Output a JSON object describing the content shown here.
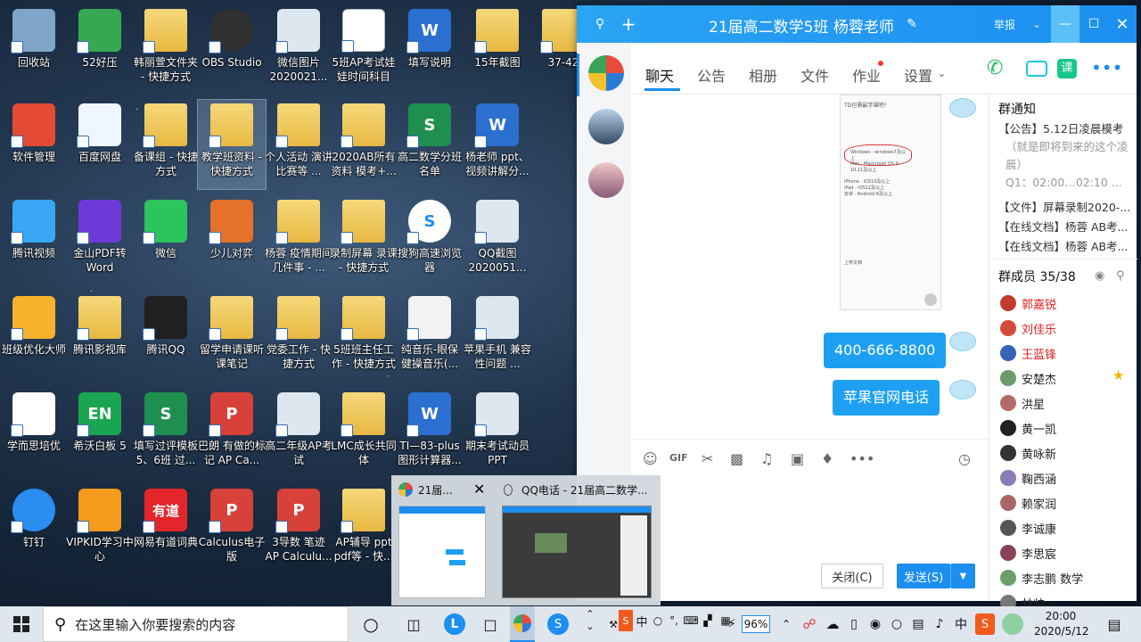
{
  "desktop_icons": [
    {
      "label": "回收站",
      "kind": "recycle"
    },
    {
      "label": "52好压",
      "kind": "zip"
    },
    {
      "label": "韩丽萱文件夹 - 快捷方式",
      "kind": "folder"
    },
    {
      "label": "OBS Studio",
      "kind": "obs"
    },
    {
      "label": "微信图片 2020021...",
      "kind": "image"
    },
    {
      "label": "5班AP考试娃娃时间科目",
      "kind": "doc"
    },
    {
      "label": "填写说明",
      "kind": "word"
    },
    {
      "label": "15年截图",
      "kind": "folder"
    },
    {
      "label": "37-42",
      "kind": "folder"
    },
    {
      "label": "软件管理",
      "kind": "softmgr"
    },
    {
      "label": "百度网盘",
      "kind": "baidu"
    },
    {
      "label": "备课组 - 快捷方式",
      "kind": "folder"
    },
    {
      "label": "教学班资料 - 快捷方式",
      "kind": "folder"
    },
    {
      "label": "个人活动 演讲 比赛等 ...",
      "kind": "folder"
    },
    {
      "label": "2020AB所有资料 模考+...",
      "kind": "folder"
    },
    {
      "label": "高二数学分班名单",
      "kind": "excel"
    },
    {
      "label": "杨老师 ppt、视频讲解分...",
      "kind": "word"
    },
    {
      "label": "腾讯视频",
      "kind": "tvideo"
    },
    {
      "label": "金山PDF转Word",
      "kind": "jspdf"
    },
    {
      "label": "微信",
      "kind": "wechat"
    },
    {
      "label": "少儿对弈",
      "kind": "chess"
    },
    {
      "label": "杨蓉 疫情期间几件事 - ...",
      "kind": "folder"
    },
    {
      "label": "录制屏幕 录课 - 快捷方式",
      "kind": "folder"
    },
    {
      "label": "搜狗高速浏览器",
      "kind": "sogou"
    },
    {
      "label": "QQ截图 2020051...",
      "kind": "image"
    },
    {
      "label": "班级优化大师",
      "kind": "banji"
    },
    {
      "label": "腾讯影视库",
      "kind": "folder"
    },
    {
      "label": "腾讯QQ",
      "kind": "qq"
    },
    {
      "label": "留学申请课听课笔记",
      "kind": "folder"
    },
    {
      "label": "党委工作 - 快捷方式",
      "kind": "folder"
    },
    {
      "label": "5班班主任工作 - 快捷方式",
      "kind": "folder"
    },
    {
      "label": "纯音乐-眼保健操音乐(...",
      "kind": "music"
    },
    {
      "label": "苹果手机 兼容性问题 ...",
      "kind": "image"
    },
    {
      "label": "学而思培优",
      "kind": "xes"
    },
    {
      "label": "希沃白板 5",
      "kind": "en"
    },
    {
      "label": "填写过评模板5、6班 过...",
      "kind": "excel"
    },
    {
      "label": "巴朗 有做的标记 AP Ca...",
      "kind": "pdf"
    },
    {
      "label": "高二年级AP考试",
      "kind": "image"
    },
    {
      "label": "LMC成长共同体",
      "kind": "folder"
    },
    {
      "label": "TI—83-plus图形计算器...",
      "kind": "word"
    },
    {
      "label": "期末考试动员PPT",
      "kind": "image"
    },
    {
      "label": "钉钉",
      "kind": "dingtalk"
    },
    {
      "label": "VIPKID学习中心",
      "kind": "vipkid"
    },
    {
      "label": "网易有道词典",
      "kind": "youdao"
    },
    {
      "label": "Calculus电子版",
      "kind": "pdf"
    },
    {
      "label": "3导数 笔迹 AP Calculu...",
      "kind": "pdf"
    },
    {
      "label": "AP辅导 ppt pdf等 - 快...",
      "kind": "folder"
    }
  ],
  "qq_window": {
    "title": "21届高二数学5班 杨蓉老师",
    "report": "举报",
    "tabs": [
      "聊天",
      "公告",
      "相册",
      "文件",
      "作业",
      "设置"
    ],
    "messages": [
      "400-666-8800",
      "苹果官网电话"
    ],
    "screenshot_text": {
      "head": "TD也需最学课吧?",
      "lines": [
        "Windows · windows7及以上",
        "Mac · Macintosh OS X 10.11及以上",
        "iPhone · iOS10及以上",
        "iPad · iOS12及以上",
        "安卓 · Android 8及以上"
      ],
      "foot": "上传文档"
    },
    "close_label": "关闭(C)",
    "send_label": "发送(S)",
    "notice_title": "群通知",
    "notices": [
      "【公告】5.12日凌晨模考",
      "（就是即将到来的这个凌",
      "晨）",
      "Q1：02:00…02:10 ...",
      "【文件】屏幕录制2020-...",
      "【在线文档】杨蓉 AB考...",
      "【在线文档】杨蓉 AB考..."
    ],
    "members_title": "群成员 35/38",
    "members": [
      {
        "name": "郭嘉锐",
        "color": "#e02020"
      },
      {
        "name": "刘佳乐",
        "color": "#e02020"
      },
      {
        "name": "王蓝锋",
        "color": "#e02020"
      },
      {
        "name": "安楚杰",
        "color": "#222222"
      },
      {
        "name": "洪星",
        "color": "#222222"
      },
      {
        "name": "黄一凯",
        "color": "#222222"
      },
      {
        "name": "黄咏新",
        "color": "#222222"
      },
      {
        "name": "鞠西涵",
        "color": "#222222"
      },
      {
        "name": "赖家润",
        "color": "#222222"
      },
      {
        "name": "李诚康",
        "color": "#222222"
      },
      {
        "name": "李思宸",
        "color": "#222222"
      },
      {
        "name": "李志鹏 数学",
        "color": "#222222"
      },
      {
        "name": "林帅",
        "color": "#222222"
      }
    ]
  },
  "thumbnails": [
    {
      "title": "21届..."
    },
    {
      "title": "QQ电话 - 21届高二数学..."
    }
  ],
  "taskbar": {
    "search_placeholder": "在这里输入你要搜索的内容",
    "battery": "96%",
    "ime": "中",
    "time": "20:00",
    "date": "2020/5/12"
  },
  "colors": {
    "accent": "#1c8ef0",
    "bubble": "#1ea0f2",
    "taskbar": "#dfe6ee"
  }
}
